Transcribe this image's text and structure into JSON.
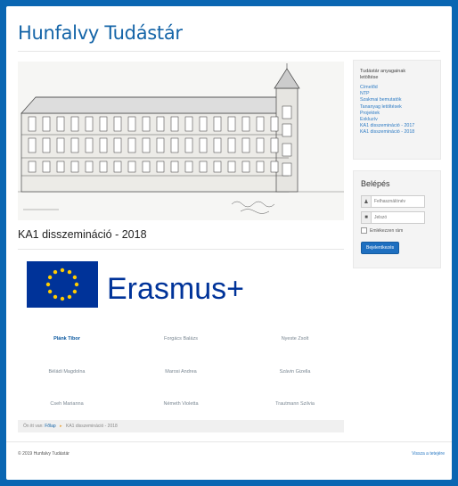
{
  "site": {
    "title": "Hunfalvy Tudástár"
  },
  "sidebar_downloads": {
    "heading": "Tudástár anyagainak letöltése",
    "links": [
      "Címelőd",
      "NTP",
      "Szakmai bemutatók",
      "Tananyag letöltések",
      "Projektek",
      "Exkluzív",
      "KA1 disszemináció - 2017",
      "KA1 disszemináció - 2018"
    ]
  },
  "login": {
    "heading": "Belépés",
    "username_placeholder": "Felhasználónév",
    "password_placeholder": "Jelszó",
    "remember_label": "Emlékezzen rám",
    "submit_label": "Bejelentkezés"
  },
  "article": {
    "title": "KA1 disszemináció - 2018",
    "logo_text": "Erasmus+",
    "people": [
      [
        "Plánk Tibor",
        "Forgács Balázs",
        "Nyeste Zsolt"
      ],
      [
        "Béládi Magdolna",
        "Marosi Andrea",
        "Szávin Gizella"
      ],
      [
        "Cseh Marianna",
        "Németh Violetta",
        "Trautmann Szilvia"
      ]
    ]
  },
  "breadcrumb": {
    "prefix": "Ön itt van:",
    "home": "Főlap",
    "current": "KA1 disszemináció - 2018"
  },
  "footer": {
    "copyright": "© 2019 Hunfalvy Tudástár",
    "back_to_top": "Vissza a tetejére"
  },
  "colors": {
    "frame": "#0a66b2",
    "link": "#2d7bc4",
    "eu_blue": "#003399",
    "eu_star": "#ffcc00"
  }
}
